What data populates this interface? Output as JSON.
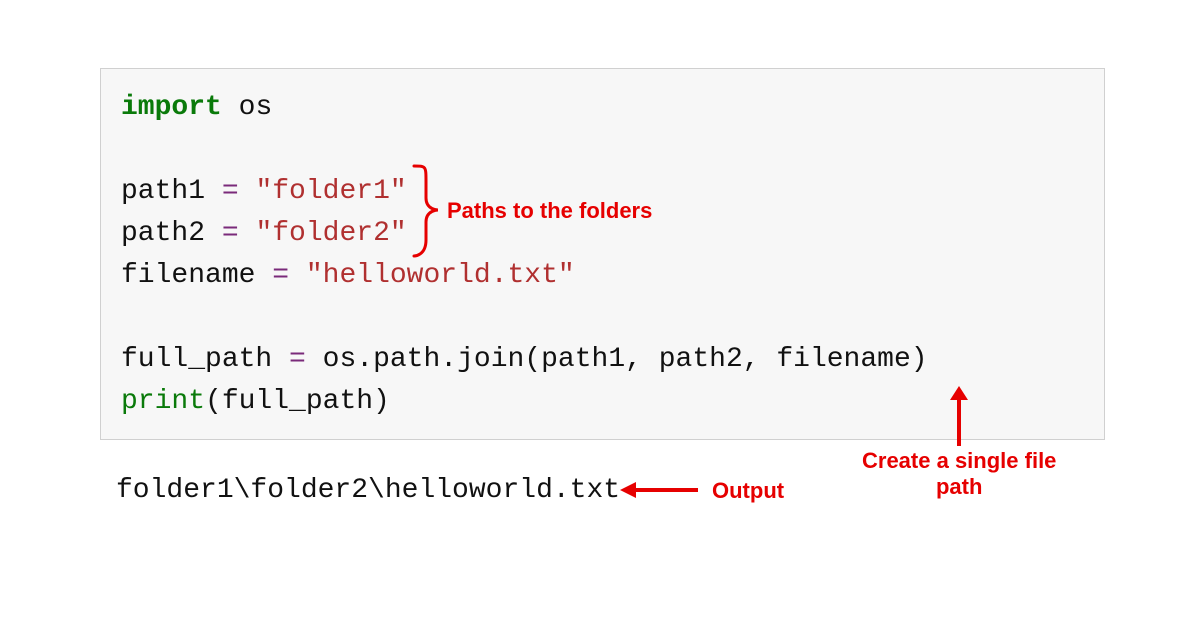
{
  "code": {
    "line1": {
      "import": "import",
      "os": "os"
    },
    "line3": {
      "var": "path1",
      "eq": "=",
      "val": "\"folder1\""
    },
    "line4": {
      "var": "path2",
      "eq": "=",
      "val": "\"folder2\""
    },
    "line5": {
      "var": "filename",
      "eq": "=",
      "val": "\"helloworld.txt\""
    },
    "line7": {
      "var": "full_path",
      "eq": "=",
      "rhs": "os.path.join(path1, path2, filename)"
    },
    "line8": {
      "fn": "print",
      "rest": "(full_path)"
    }
  },
  "output": "folder1\\folder2\\helloworld.txt",
  "annotations": {
    "paths": "Paths to the folders",
    "output_label": "Output",
    "create": "Create a single file\npath"
  }
}
